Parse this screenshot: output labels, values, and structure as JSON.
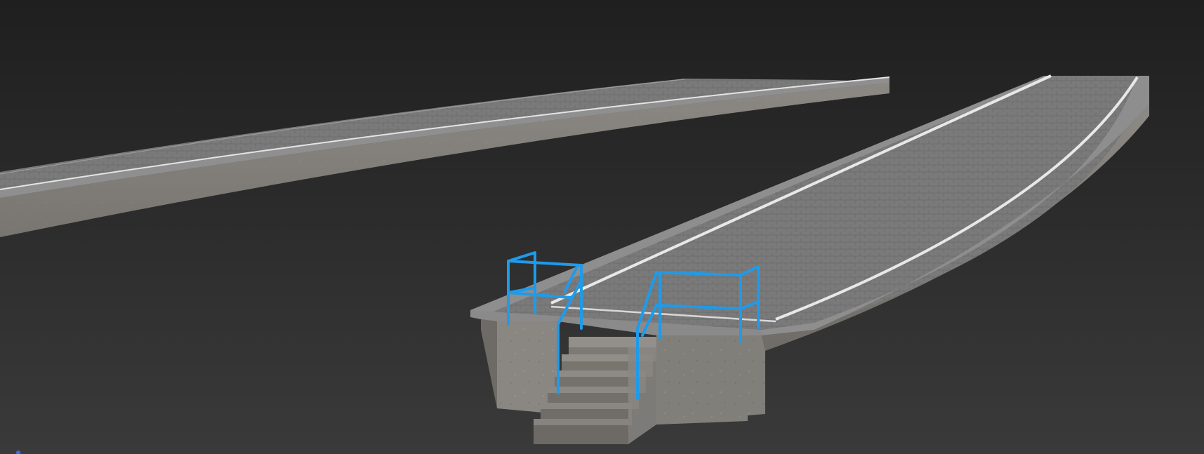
{
  "viewport": {
    "background_top": "#1f1f1f",
    "background_bottom": "#3a3a3a"
  },
  "scene": {
    "objects": [
      "left-platform",
      "right-platform",
      "stairs",
      "left-railing",
      "right-railing"
    ]
  },
  "colors": {
    "paving": "#7c7c7c",
    "paving_dark": "#6a6a6a",
    "concrete_wall": "#8a8782",
    "concrete_wall_dark": "#6f6c67",
    "edge_line": "#e8e8e8",
    "railing": "#1e9bea",
    "curb": "#8e8e8e"
  }
}
